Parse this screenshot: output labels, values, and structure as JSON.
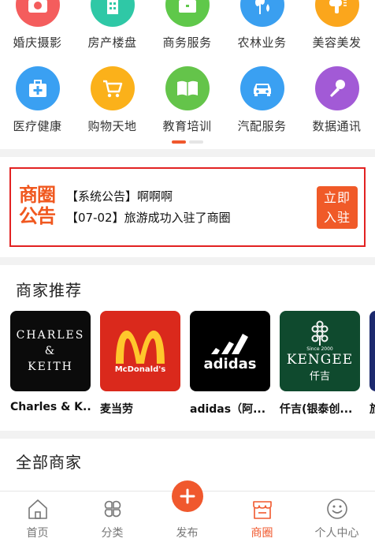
{
  "categories": [
    {
      "label": "婚庆摄影",
      "icon": "camera-heart-icon",
      "color": "#f45d5d"
    },
    {
      "label": "房产楼盘",
      "icon": "building-icon",
      "color": "#2fc8a6"
    },
    {
      "label": "商务服务",
      "icon": "briefcase-icon",
      "color": "#5fc84a"
    },
    {
      "label": "农林业务",
      "icon": "wheat-icon",
      "color": "#3a9ff0"
    },
    {
      "label": "美容美发",
      "icon": "hair-dryer-icon",
      "color": "#fba61c"
    },
    {
      "label": "医疗健康",
      "icon": "medical-kit-icon",
      "color": "#3aa0f2"
    },
    {
      "label": "购物天地",
      "icon": "shopping-cart-icon",
      "color": "#fbb11a"
    },
    {
      "label": "教育培训",
      "icon": "book-icon",
      "color": "#64c44a"
    },
    {
      "label": "汽配服务",
      "icon": "car-icon",
      "color": "#3aa0f2"
    },
    {
      "label": "数据通讯",
      "icon": "microphone-icon",
      "color": "#a25ad6"
    }
  ],
  "notice": {
    "logo_line1": "商圈",
    "logo_line2": "公告",
    "line1": "【系统公告】啊啊啊",
    "line2": "【07-02】旅游成功入驻了商圈",
    "join_line1": "立即",
    "join_line2": "入驻"
  },
  "recommend": {
    "title": "商家推荐",
    "brands": [
      {
        "name": "Charles & K...",
        "logo_line1": "CHARLES",
        "logo_line2": "&",
        "logo_line3": "KEITH"
      },
      {
        "name": "麦当劳",
        "logo_text": "McDonald's"
      },
      {
        "name": "adidas（阿...",
        "logo_text": "adidas"
      },
      {
        "name": "仟吉(银泰创...",
        "logo_line1": "Since 2000",
        "logo_line2": "KENGEE",
        "logo_line3": "仟吉"
      },
      {
        "name": "旅"
      }
    ]
  },
  "all_merchants": {
    "title": "全部商家"
  },
  "tabbar": {
    "home": "首页",
    "category": "分类",
    "publish": "发布",
    "circle": "商圈",
    "profile": "个人中心"
  },
  "colors": {
    "accent": "#f0582d",
    "notice_border": "#e22222"
  }
}
